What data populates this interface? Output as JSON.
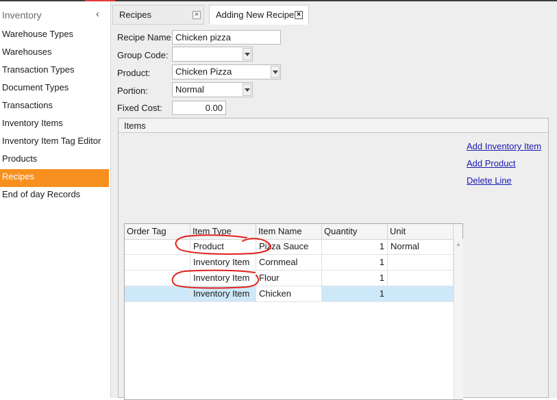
{
  "sidebar": {
    "title": "Inventory",
    "items": [
      {
        "label": "Warehouse Types",
        "active": false
      },
      {
        "label": "Warehouses",
        "active": false
      },
      {
        "label": "Transaction Types",
        "active": false
      },
      {
        "label": "Document Types",
        "active": false
      },
      {
        "label": "Transactions",
        "active": false
      },
      {
        "label": "Inventory Items",
        "active": false
      },
      {
        "label": "Inventory Item Tag Editor",
        "active": false
      },
      {
        "label": "Products",
        "active": false
      },
      {
        "label": "Recipes",
        "active": true
      },
      {
        "label": "End of day Records",
        "active": false
      }
    ]
  },
  "tabs": [
    {
      "label": "Recipes",
      "active": false
    },
    {
      "label": "Adding New Recipe",
      "active": true
    }
  ],
  "form": {
    "recipe_name_label": "Recipe Name:",
    "recipe_name_value": "Chicken pizza",
    "group_code_label": "Group Code:",
    "group_code_value": "",
    "product_label": "Product:",
    "product_value": "Chicken Pizza",
    "portion_label": "Portion:",
    "portion_value": "Normal",
    "fixed_cost_label": "Fixed Cost:",
    "fixed_cost_value": "0.00"
  },
  "items_group": {
    "title": "Items",
    "links": {
      "add_inventory_item": "Add Inventory Item",
      "add_product": "Add Product",
      "delete_line": "Delete Line"
    },
    "columns": [
      "Order Tag",
      "Item Type",
      "Item Name",
      "Quantity",
      "Unit"
    ],
    "rows": [
      {
        "order_tag": "",
        "item_type": "Product",
        "item_name": "Pizza Sauce",
        "quantity": "1",
        "unit": "Normal",
        "selected": false
      },
      {
        "order_tag": "",
        "item_type": "Inventory Item",
        "item_name": "Cornmeal",
        "quantity": "1",
        "unit": "",
        "selected": false
      },
      {
        "order_tag": "",
        "item_type": "Inventory Item",
        "item_name": "Flour",
        "quantity": "1",
        "unit": "",
        "selected": false
      },
      {
        "order_tag": "",
        "item_type": "Inventory Item",
        "item_name": "Chicken",
        "quantity": "1",
        "unit": "",
        "selected": true
      }
    ]
  },
  "colors": {
    "sidebar_active": "#f7901e",
    "selected_row": "#cde8f8",
    "link": "#1a1ab0",
    "annotation": "#e0201c"
  }
}
